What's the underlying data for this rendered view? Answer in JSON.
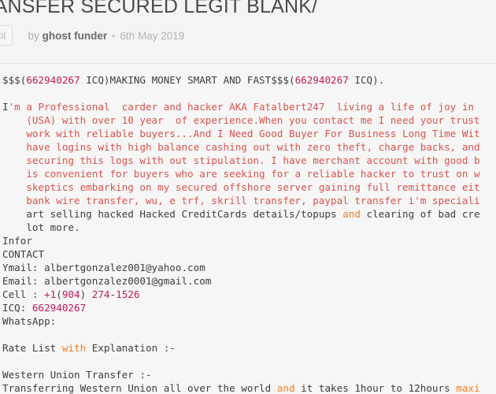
{
  "header": {
    "title": "ANCE TRANSFER SECURED LEGIT BLANK/",
    "language_badge": "cript",
    "by_label": "by",
    "author": "ghost funder",
    "separator": "•",
    "date": "6th May 2019"
  },
  "colors": {
    "page_background": "#f2f2f2",
    "code_background": "#f6f6f6",
    "number_token": "#c2185b",
    "string_token": "#d9534f",
    "keyword_token": "#f57c20",
    "plain_text": "#3d3d3d",
    "title_text": "#4a4a4a",
    "meta_text": "#adadad",
    "divider": "#e2e2e2"
  },
  "code": {
    "lines": [
      [
        {
          "t": "$$$(",
          "c": "txt"
        },
        {
          "t": "662940267",
          "c": "num"
        },
        {
          "t": " ICQ)MAKING MONEY SMART AND FAST$$$(",
          "c": "txt"
        },
        {
          "t": "662940267",
          "c": "num"
        },
        {
          "t": " ICQ).",
          "c": "txt"
        }
      ],
      [],
      [
        {
          "t": "I",
          "c": "txt"
        },
        {
          "t": "'m a Professional  carder and hacker AKA Fatalbert247  living a life of joy in",
          "c": "str"
        }
      ],
      [
        {
          "t": "    (USA) with over 10 year  of experience.When you contact me I need your trust",
          "c": "str"
        }
      ],
      [
        {
          "t": "    work with reliable buyers...And I Need Good Buyer For Business Long Time Wit",
          "c": "str"
        }
      ],
      [
        {
          "t": "    have logins with high balance cashing out with zero theft, charge backs, and",
          "c": "str"
        }
      ],
      [
        {
          "t": "    securing this logs with out stipulation. I have merchant account with good b",
          "c": "str"
        }
      ],
      [
        {
          "t": "    is convenient for buyers who are seeking for a reliable hacker to trust on w",
          "c": "str"
        }
      ],
      [
        {
          "t": "    skeptics embarking on my secured offshore server gaining full remittance eit",
          "c": "str"
        }
      ],
      [
        {
          "t": "    bank wire transfer, wu, e trf, skrill transfer, paypal transfer i'm speciali",
          "c": "str"
        }
      ],
      [
        {
          "t": "    art selling hacked Hacked CreditCards details/topups ",
          "c": "txt"
        },
        {
          "t": "and",
          "c": "kw"
        },
        {
          "t": " clearing of bad cre",
          "c": "txt"
        }
      ],
      [
        {
          "t": "    lot more.",
          "c": "txt"
        }
      ],
      [
        {
          "t": "Infor",
          "c": "txt"
        }
      ],
      [
        {
          "t": "CONTACT",
          "c": "txt"
        }
      ],
      [
        {
          "t": "Ymail: albertgonzalez001@yahoo.com",
          "c": "txt"
        }
      ],
      [
        {
          "t": "Email: albertgonzalez0001@gmail.com",
          "c": "txt"
        }
      ],
      [
        {
          "t": "Cell : ",
          "c": "txt"
        },
        {
          "t": "+1",
          "c": "num"
        },
        {
          "t": "(",
          "c": "txt"
        },
        {
          "t": "904",
          "c": "num"
        },
        {
          "t": ") ",
          "c": "txt"
        },
        {
          "t": "274",
          "c": "num"
        },
        {
          "t": "-",
          "c": "txt"
        },
        {
          "t": "1526",
          "c": "num"
        }
      ],
      [
        {
          "t": "ICQ: ",
          "c": "txt"
        },
        {
          "t": "662940267",
          "c": "num"
        }
      ],
      [
        {
          "t": "WhatsApp:",
          "c": "txt"
        }
      ],
      [],
      [
        {
          "t": "Rate List ",
          "c": "txt"
        },
        {
          "t": "with",
          "c": "kw"
        },
        {
          "t": " Explanation :-",
          "c": "txt"
        }
      ],
      [],
      [
        {
          "t": "Western Union Transfer :-",
          "c": "txt"
        }
      ],
      [
        {
          "t": "Transferring Western Union all over the world ",
          "c": "txt"
        },
        {
          "t": "and",
          "c": "kw"
        },
        {
          "t": " it takes 1hour to 12hours ",
          "c": "txt"
        },
        {
          "t": "maxi",
          "c": "kw"
        }
      ]
    ]
  }
}
